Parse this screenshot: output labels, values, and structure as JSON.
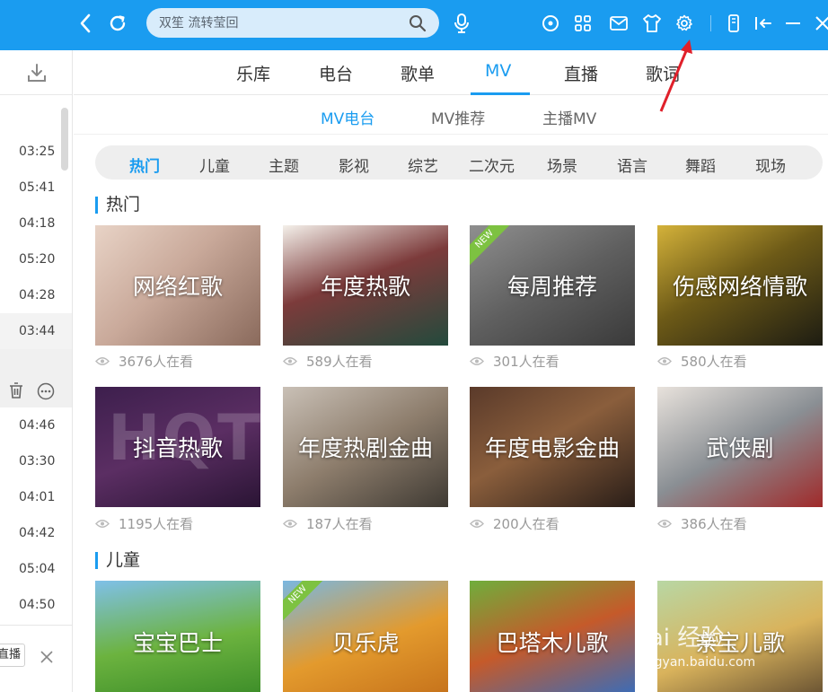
{
  "search": {
    "placeholder": "双笙 流转莹回"
  },
  "tabs": [
    "乐库",
    "电台",
    "歌单",
    "MV",
    "直播",
    "歌词"
  ],
  "subtabs": [
    "MV电台",
    "MV推荐",
    "主播MV"
  ],
  "categories": [
    "热门",
    "儿童",
    "主题",
    "影视",
    "综艺",
    "二次元",
    "场景",
    "语言",
    "舞蹈",
    "现场"
  ],
  "sidebar": {
    "durations": [
      "03:25",
      "05:41",
      "04:18",
      "05:20",
      "04:28",
      "03:44",
      "04:46",
      "03:30",
      "04:01",
      "04:42",
      "05:04",
      "04:50"
    ],
    "live_label": "直播"
  },
  "sections": [
    {
      "title": "热门",
      "cards": [
        {
          "title": "网络红歌",
          "views": "3676人在看",
          "badge": ""
        },
        {
          "title": "年度热歌",
          "views": "589人在看",
          "badge": ""
        },
        {
          "title": "每周推荐",
          "views": "301人在看",
          "badge": "NEW"
        },
        {
          "title": "伤感网络情歌",
          "views": "580人在看",
          "badge": ""
        },
        {
          "title": "抖音热歌",
          "views": "1195人在看",
          "badge": "",
          "art_text": "HQT"
        },
        {
          "title": "年度热剧金曲",
          "views": "187人在看",
          "badge": ""
        },
        {
          "title": "年度电影金曲",
          "views": "200人在看",
          "badge": ""
        },
        {
          "title": "武侠剧",
          "views": "386人在看",
          "badge": ""
        }
      ]
    },
    {
      "title": "儿童",
      "cards": [
        {
          "title": "宝宝巴士",
          "badge": ""
        },
        {
          "title": "贝乐虎",
          "badge": "NEW"
        },
        {
          "title": "巴塔木儿歌",
          "badge": ""
        },
        {
          "title": "亲宝儿歌",
          "badge": ""
        }
      ]
    }
  ],
  "watermark": {
    "main": "Bai 经验",
    "sub": "jingyan.baidu.com"
  },
  "colors": {
    "accent": "#1a9cf0",
    "topbar": "#1a9cf0",
    "annotation_arrow": "#e0202a"
  }
}
